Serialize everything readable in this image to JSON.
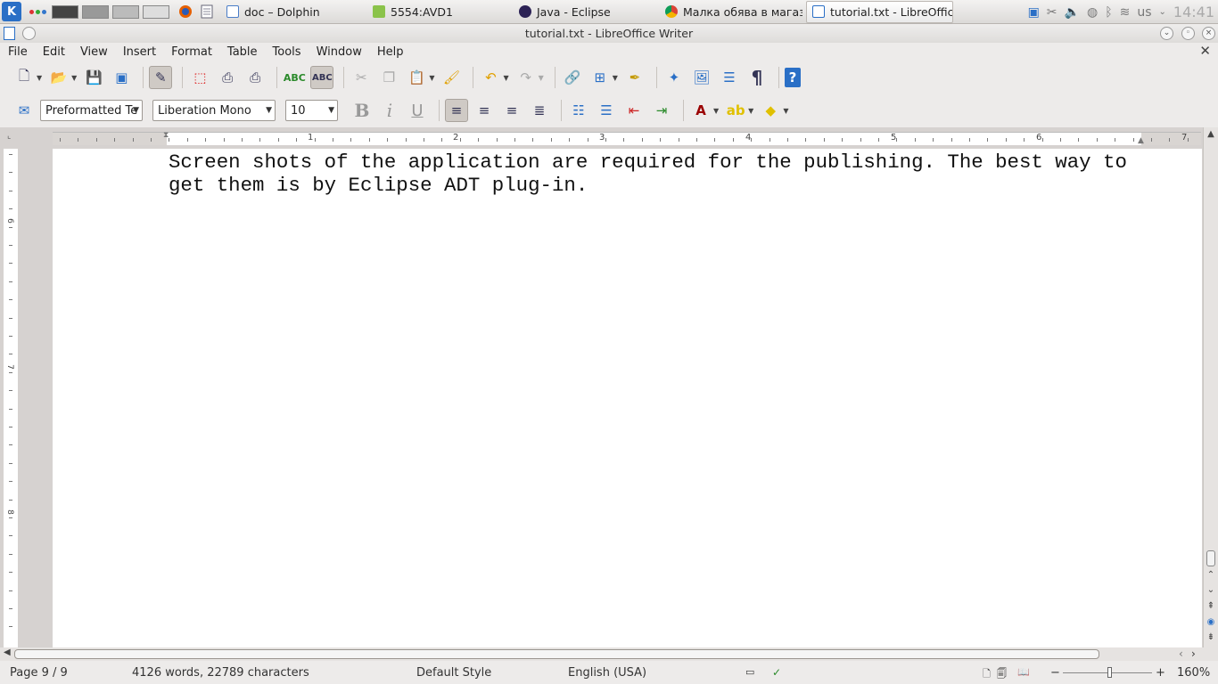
{
  "taskbar": {
    "tasks": [
      {
        "label": "doc – Dolphin"
      },
      {
        "label": "5554:AVD1"
      },
      {
        "label": "Java - Eclipse"
      },
      {
        "label": "Малка обява в магази"
      },
      {
        "label": "tutorial.txt - LibreOffic"
      }
    ],
    "keyboard_layout": "us",
    "clock": "14:41"
  },
  "window": {
    "title": "tutorial.txt - LibreOffice Writer"
  },
  "menu": [
    "File",
    "Edit",
    "View",
    "Insert",
    "Format",
    "Table",
    "Tools",
    "Window",
    "Help"
  ],
  "formatting": {
    "paragraph_style": "Preformatted Te",
    "font_name": "Liberation Mono",
    "font_size": "10"
  },
  "ruler": {
    "numbers": [
      "1",
      "2",
      "3",
      "4",
      "5",
      "6",
      "7"
    ],
    "vertical_numbers": [
      "6",
      "7",
      "8"
    ]
  },
  "document": {
    "lines": [
      "Screen shots of the application are required for the publishing. The best way to",
      "get them is by Eclipse ADT plug-in."
    ]
  },
  "status": {
    "page": "Page 9 / 9",
    "word_count": "4126 words, 22789 characters",
    "page_style": "Default Style",
    "language": "English (USA)",
    "zoom": "160%"
  }
}
